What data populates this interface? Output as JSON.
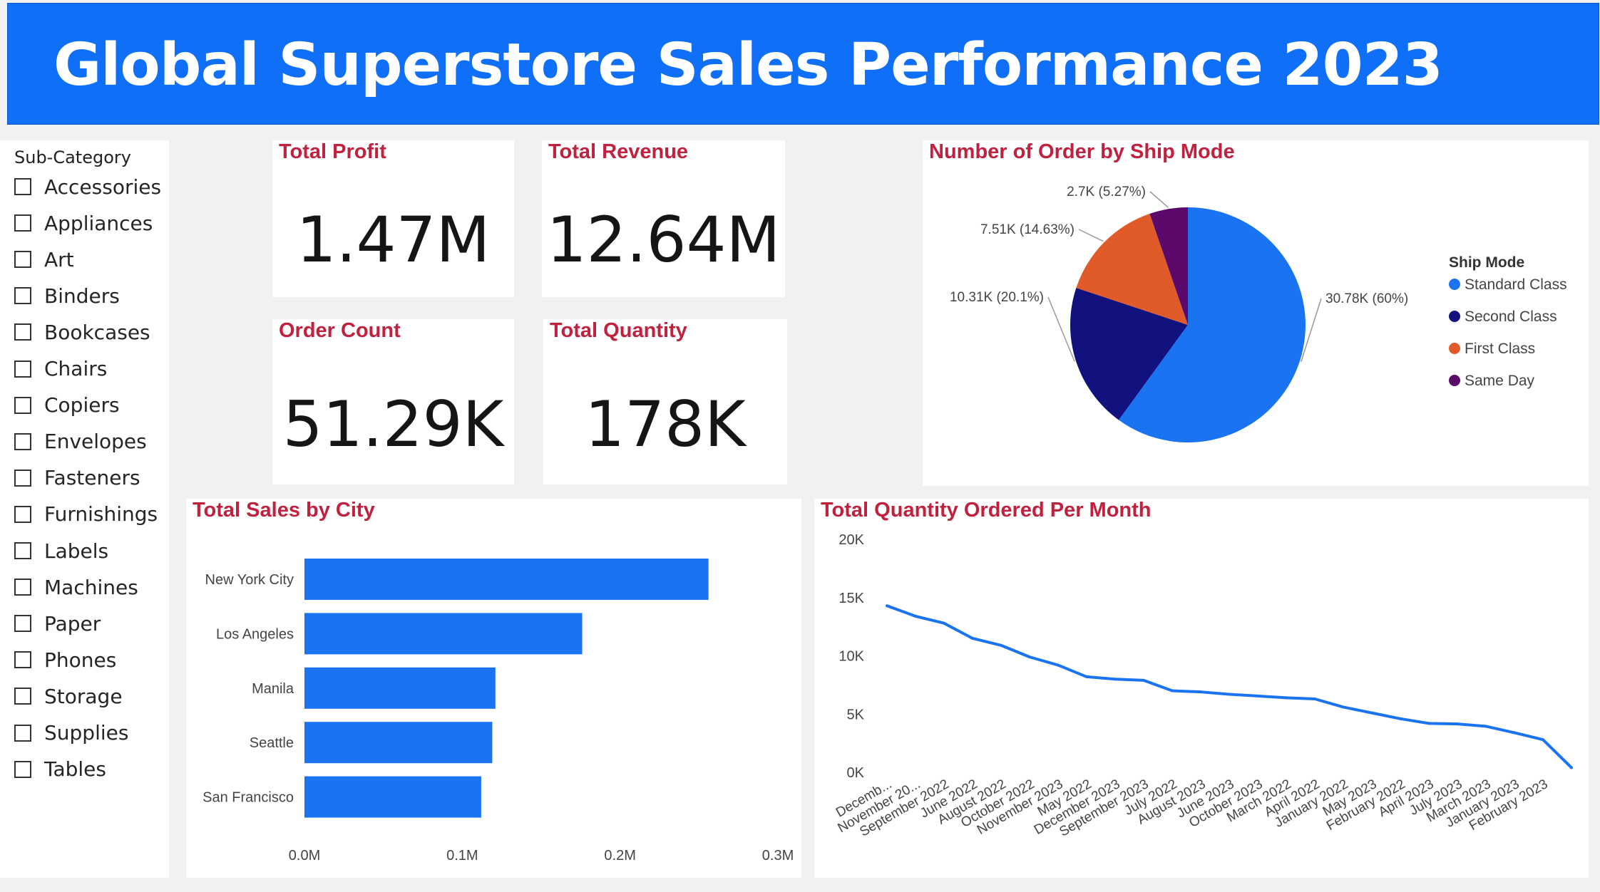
{
  "header": {
    "title": "Global Superstore Sales Performance 2023"
  },
  "slicer": {
    "title": "Sub-Category",
    "items": [
      "Accessories",
      "Appliances",
      "Art",
      "Binders",
      "Bookcases",
      "Chairs",
      "Copiers",
      "Envelopes",
      "Fasteners",
      "Furnishings",
      "Labels",
      "Machines",
      "Paper",
      "Phones",
      "Storage",
      "Supplies",
      "Tables"
    ]
  },
  "kpis": {
    "profit": {
      "title": "Total Profit",
      "value": "1.47M"
    },
    "revenue": {
      "title": "Total Revenue",
      "value": "12.64M"
    },
    "orders": {
      "title": "Order Count",
      "value": "51.29K"
    },
    "quantity": {
      "title": "Total Quantity",
      "value": "178K"
    }
  },
  "colors": {
    "banner": "#0f6ff6",
    "title_red": "#c0213e",
    "blue": "#1a73f0",
    "navy": "#12127f",
    "orange": "#e05a2a",
    "purple": "#5b0a6b"
  },
  "chart_data": [
    {
      "type": "pie",
      "title": "Number of Order by Ship Mode",
      "legend_title": "Ship Mode",
      "legend_position": "right",
      "slices": [
        {
          "name": "Standard Class",
          "value": 30.78,
          "label": "30.78K (60%)",
          "color": "#1a73f0"
        },
        {
          "name": "Second Class",
          "value": 10.31,
          "label": "10.31K (20.1%)",
          "color": "#12127f"
        },
        {
          "name": "First Class",
          "value": 7.51,
          "label": "7.51K (14.63%)",
          "color": "#e05a2a"
        },
        {
          "name": "Same Day",
          "value": 2.7,
          "label": "2.7K (5.27%)",
          "color": "#5b0a6b"
        }
      ]
    },
    {
      "type": "bar",
      "orientation": "horizontal",
      "title": "Total Sales by City",
      "categories": [
        "New York City",
        "Los Angeles",
        "Manila",
        "Seattle",
        "San Francisco"
      ],
      "values": [
        0.256,
        0.176,
        0.121,
        0.119,
        0.112
      ],
      "xlim": [
        0,
        0.3
      ],
      "xticks": [
        "0.0M",
        "0.1M",
        "0.2M",
        "0.3M"
      ],
      "color": "#1a73f0"
    },
    {
      "type": "line",
      "title": "Total Quantity Ordered Per Month",
      "x": [
        "Decemb...",
        "November 20...",
        "September 2022",
        "June 2022",
        "August 2022",
        "October 2022",
        "November 2023",
        "May 2022",
        "December 2023",
        "September 2023",
        "July 2022",
        "August 2023",
        "June 2023",
        "October 2023",
        "March 2022",
        "April 2022",
        "January 2022",
        "May 2023",
        "February 2022",
        "April 2023",
        "July 2023",
        "March 2023",
        "January 2023",
        "February 2023"
      ],
      "values": [
        14300,
        13400,
        12800,
        11500,
        10900,
        9900,
        9200,
        8200,
        8000,
        7900,
        7000,
        6900,
        6700,
        6550,
        6400,
        6300,
        5600,
        5100,
        4600,
        4200,
        4150,
        3950,
        3400,
        2800,
        400
      ],
      "ylim": [
        0,
        20000
      ],
      "yticks": [
        "0K",
        "5K",
        "10K",
        "15K",
        "20K"
      ],
      "color": "#1a73f0"
    }
  ]
}
